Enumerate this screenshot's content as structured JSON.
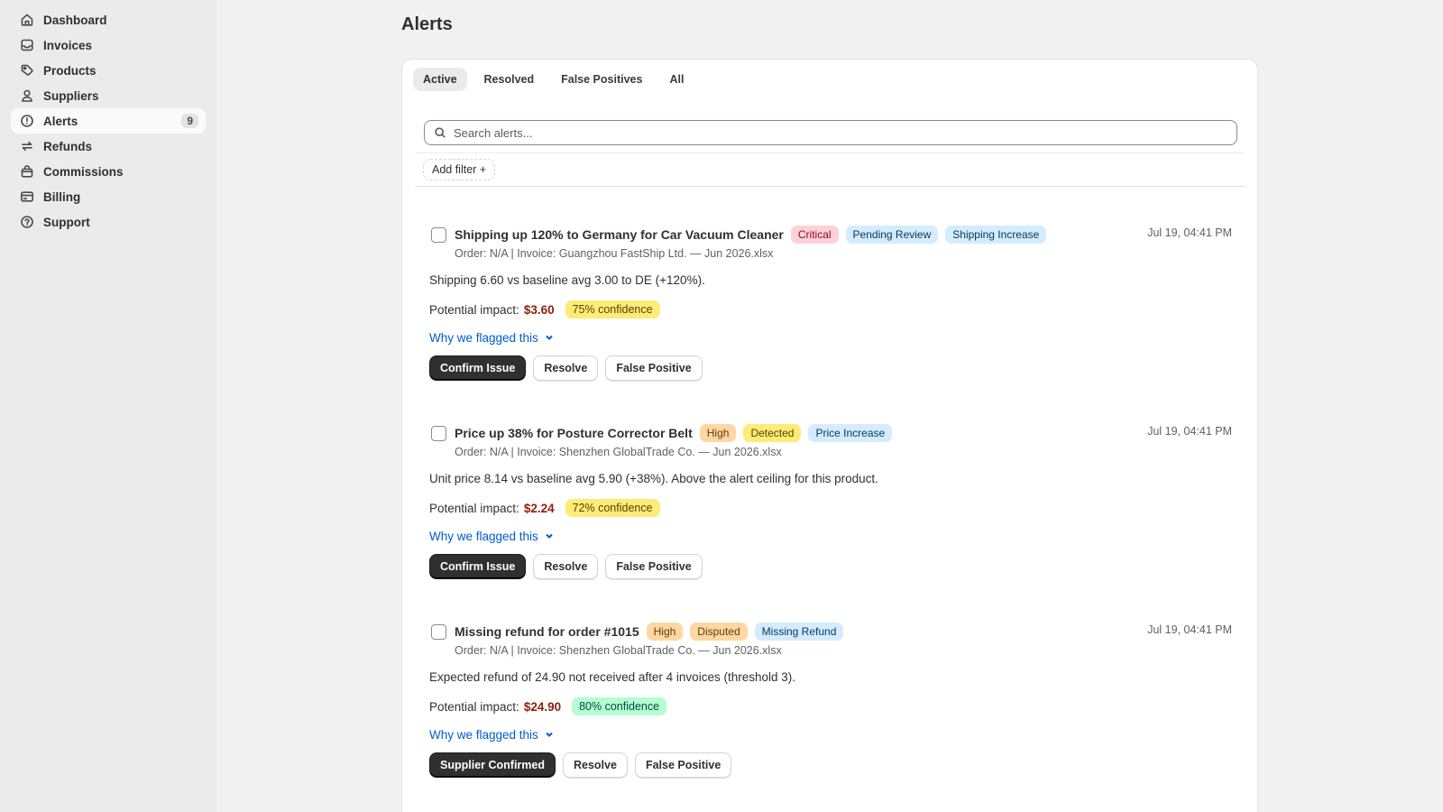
{
  "sidebar": {
    "items": [
      {
        "label": "Dashboard",
        "icon": "home-icon"
      },
      {
        "label": "Invoices",
        "icon": "inbox-icon"
      },
      {
        "label": "Products",
        "icon": "tag-icon"
      },
      {
        "label": "Suppliers",
        "icon": "person-icon"
      },
      {
        "label": "Alerts",
        "icon": "alert-circle-icon",
        "count": "9",
        "active": true
      },
      {
        "label": "Refunds",
        "icon": "refresh-icon"
      },
      {
        "label": "Commissions",
        "icon": "bag-icon"
      },
      {
        "label": "Billing",
        "icon": "credit-card-icon"
      },
      {
        "label": "Support",
        "icon": "question-circle-icon"
      }
    ]
  },
  "page": {
    "title": "Alerts"
  },
  "tabs": [
    {
      "label": "Active",
      "active": true
    },
    {
      "label": "Resolved"
    },
    {
      "label": "False Positives"
    },
    {
      "label": "All"
    }
  ],
  "search": {
    "placeholder": "Search alerts..."
  },
  "filter": {
    "add_label": "Add filter +"
  },
  "alerts": [
    {
      "title": "Shipping up 120% to Germany for Car Vacuum Cleaner",
      "severity": "Critical",
      "status": "Pending Review",
      "type": "Shipping Increase",
      "time": "Jul 19, 04:41 PM",
      "meta": "Order: N/A | Invoice: Guangzhou FastShip Ltd. — Jun 2026.xlsx",
      "description": "Shipping 6.60 vs baseline avg 3.00 to DE (+120%).",
      "impact_label": "Potential impact:",
      "impact": "$3.60",
      "confidence": "75% confidence",
      "why": "Why we flagged this",
      "actions": [
        "Confirm Issue",
        "Resolve",
        "False Positive"
      ]
    },
    {
      "title": "Price up 38% for Posture Corrector Belt",
      "severity": "High",
      "status": "Detected",
      "type": "Price Increase",
      "time": "Jul 19, 04:41 PM",
      "meta": "Order: N/A | Invoice: Shenzhen GlobalTrade Co. — Jun 2026.xlsx",
      "description": "Unit price 8.14 vs baseline avg 5.90 (+38%). Above the alert ceiling for this product.",
      "impact_label": "Potential impact:",
      "impact": "$2.24",
      "confidence": "72% confidence",
      "why": "Why we flagged this",
      "actions": [
        "Confirm Issue",
        "Resolve",
        "False Positive"
      ]
    },
    {
      "title": "Missing refund for order #1015",
      "severity": "High",
      "status": "Disputed",
      "type": "Missing Refund",
      "time": "Jul 19, 04:41 PM",
      "meta": "Order: N/A | Invoice: Shenzhen GlobalTrade Co. — Jun 2026.xlsx",
      "description": "Expected refund of 24.90 not received after 4 invoices (threshold 3).",
      "impact_label": "Potential impact:",
      "impact": "$24.90",
      "confidence": "80% confidence",
      "why": "Why we flagged this",
      "actions": [
        "Supplier Confirmed",
        "Resolve",
        "False Positive"
      ]
    }
  ],
  "colors": {
    "critical_badge": "#fed1d7",
    "high_badge": "#ffd6a4",
    "status_blue": "#d5ebff",
    "confidence_yellow": "#ffeb78",
    "confidence_green": "#b4fed2",
    "impact_red": "#8e1f0b",
    "link_blue": "#005bd3",
    "primary_button": "#303030"
  }
}
